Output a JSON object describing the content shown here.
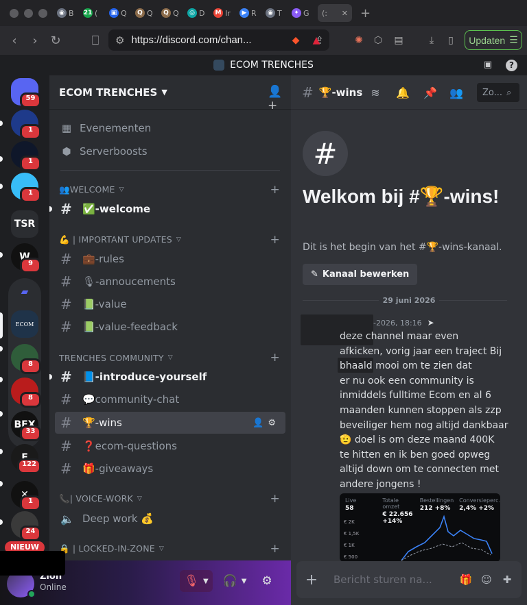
{
  "browser": {
    "tabs": [
      {
        "label": "B",
        "color": "#6b7280",
        "glyph": "◉"
      },
      {
        "label": "(",
        "color": "#16a34a",
        "glyph": "21"
      },
      {
        "label": "Q",
        "color": "#2563eb",
        "glyph": "▣"
      },
      {
        "label": "Q",
        "color": "#8b6b4a",
        "glyph": "Q"
      },
      {
        "label": "Q",
        "color": "#8b6b4a",
        "glyph": "Q"
      },
      {
        "label": "D",
        "color": "#0ea5a4",
        "glyph": "◎"
      },
      {
        "label": "Ir",
        "color": "#ea4335",
        "glyph": "M"
      },
      {
        "label": "R",
        "color": "#3b82f6",
        "glyph": "▶"
      },
      {
        "label": "T",
        "color": "#6b7280",
        "glyph": "◉"
      },
      {
        "label": "G",
        "color": "#8b5cf6",
        "glyph": "✦"
      }
    ],
    "active_tab_label": "(:",
    "url": "https://discord.com/chan...",
    "update_label": "Updaten"
  },
  "titlebar": {
    "server_name": "ECOM TRENCHES"
  },
  "servers": [
    {
      "label": "",
      "badge": "59",
      "bg": "#5865f2"
    },
    {
      "label": "",
      "badge": "1",
      "bg": "#1e3a8a"
    },
    {
      "label": "",
      "badge": "1",
      "bg": "#0f172a"
    },
    {
      "label": "",
      "badge": "1",
      "bg": "#38bdf8"
    },
    {
      "label": "TSR",
      "badge": "",
      "bg": "#2b2d31"
    },
    {
      "label": "W",
      "badge": "9",
      "bg": "#111111"
    },
    {
      "label": "",
      "badge": "",
      "bg": "#2b2d31"
    },
    {
      "label": "ECOM",
      "badge": "",
      "bg": "#1f3349"
    },
    {
      "label": "",
      "badge": "8",
      "bg": "#2f5d3a"
    },
    {
      "label": "",
      "badge": "8",
      "bg": "#b91c1c"
    },
    {
      "label": "BFX",
      "badge": "33",
      "bg": "#111111"
    },
    {
      "label": "E",
      "badge": "122",
      "bg": "#1a1a1a"
    },
    {
      "label": "✕",
      "badge": "1",
      "bg": "#111111"
    },
    {
      "label": "",
      "badge": "24",
      "bg": "#3a3a3a"
    }
  ],
  "nieuw_label": "NIEUW",
  "sidebar": {
    "server_name": "ECOM TRENCHES",
    "links": [
      {
        "label": "Evenementen"
      },
      {
        "label": "Serverboosts"
      }
    ],
    "categories": [
      {
        "label": "👥WELCOME"
      },
      {
        "label": "💪 | IMPORTANT UPDATES"
      },
      {
        "label": "TRENCHES COMMUNITY"
      },
      {
        "label": "📞| VOICE-WORK"
      },
      {
        "label": "🔒 | LOCKED-IN-ZONE"
      }
    ],
    "channels": [
      {
        "label": "✅-welcome"
      },
      {
        "label": "💼-rules"
      },
      {
        "label": "🎙-annoucements"
      },
      {
        "label": "📗-value"
      },
      {
        "label": "📗-value-feedback"
      },
      {
        "label": "📘-introduce-yourself"
      },
      {
        "label": "💬community-chat"
      },
      {
        "label": "🏆-wins"
      },
      {
        "label": "❓ecom-questions"
      },
      {
        "label": "🎁-giveaways"
      },
      {
        "label": "Deep work 💰"
      }
    ]
  },
  "user": {
    "name": "Zion",
    "status": "Online"
  },
  "chat": {
    "channel_name": "🏆-wins",
    "search_placeholder": "Zo...",
    "welcome_title": "Welkom bij #🏆-wins!",
    "welcome_sub": "Dit is het begin van het #🏆-wins-kanaal.",
    "edit_button": "Kanaal bewerken",
    "date": "29 juni 2026",
    "message": {
      "time": "-2026, 18:16",
      "body": "deze channel maar even\nafkicken,  vorig jaar een traject Bij\nbhaald mooi om te zien dat\ner nu ook een community is\ninmiddels fulltime Ecom en al 6\nmaanden kunnen stoppen als zzp\nbeveiliger hem nog altijd dankbaar\n🫡 doel is om deze maand 400K\nte hitten en ik ben goed opweg\naltijd down om te connecten met\nandere jongens !"
    },
    "image_stats": [
      {
        "label": "Live",
        "value": "58"
      },
      {
        "label": "Totale omzet",
        "value": "€ 22.656 +14%"
      },
      {
        "label": "Bestellingen",
        "value": "212 +8%"
      },
      {
        "label": "Conversieperc.",
        "value": "2,4% +2%"
      }
    ],
    "image_yticks": [
      "€ 2K",
      "€ 1,5K",
      "€ 1K",
      "€ 500"
    ],
    "composer_placeholder": "Bericht sturen na..."
  }
}
